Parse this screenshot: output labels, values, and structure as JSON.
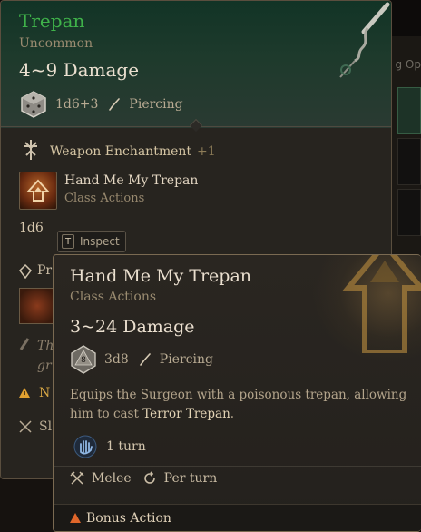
{
  "background": {
    "label_fragment": "g Op"
  },
  "item_tooltip": {
    "name": "Trepan",
    "rarity": "Uncommon",
    "damage": "4~9 Damage",
    "dice": "1d6+3",
    "damage_type": "Piercing",
    "enchant_label": "Weapon Enchantment",
    "enchant_bonus": "+1",
    "action_name": "Hand Me My Trepan",
    "action_category": "Class Actions",
    "dice_small": "1d6",
    "inspect_key": "T",
    "inspect_label": "Inspect",
    "partial_lines": [
      "Pr",
      "Th",
      "gr",
      "N",
      "Sl"
    ],
    "name_color": "#3fb24a"
  },
  "action_tooltip": {
    "title": "Hand Me My Trepan",
    "category": "Class Actions",
    "damage": "3~24 Damage",
    "dice": "3d8",
    "die_face": "8",
    "damage_type": "Piercing",
    "description_before": "Equips the Surgeon with a poisonous trepan, allowing him to cast ",
    "description_highlight": "Terror Trepan",
    "description_after": ".",
    "duration": "1 turn",
    "tag_range": "Melee",
    "tag_recharge": "Per turn",
    "cost": "Bonus Action",
    "cost_color": "#e0662a"
  }
}
